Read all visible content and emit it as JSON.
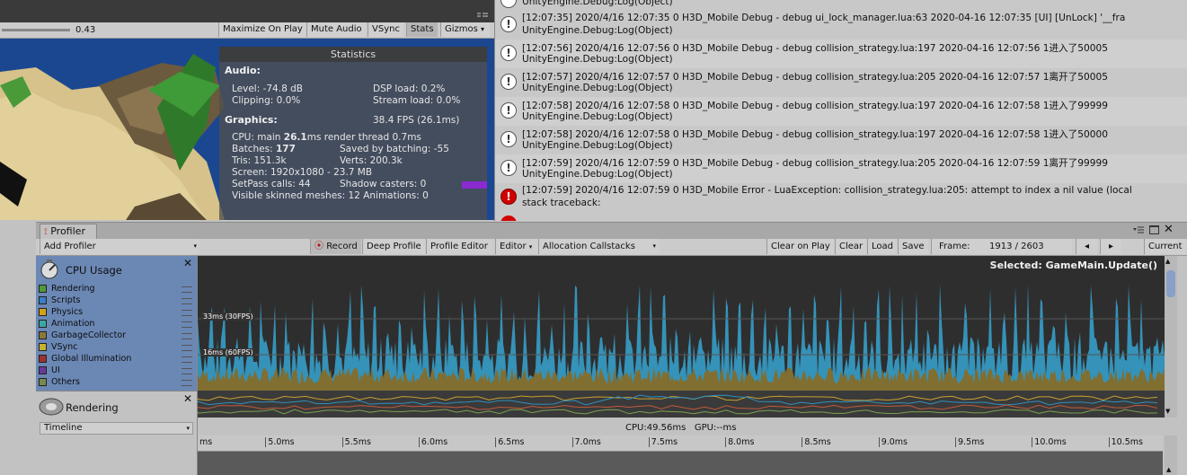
{
  "game_toolbar": {
    "slider_value": "0.43",
    "buttons": [
      "Maximize On Play",
      "Mute Audio",
      "VSync",
      "Stats",
      "Gizmos"
    ],
    "gizmos_arrow": "▾"
  },
  "stats": {
    "title": "Statistics",
    "audio_header": "Audio:",
    "level": "Level: -74.8 dB",
    "clipping": "Clipping: 0.0%",
    "dsp": "DSP load: 0.2%",
    "stream": "Stream load: 0.0%",
    "graphics_header": "Graphics:",
    "fps": "38.4 FPS (26.1ms)",
    "cpu_prefix": "CPU: main ",
    "cpu_main": "26.1",
    "cpu_suffix": "ms  render thread 0.7ms",
    "batches_prefix": "Batches: ",
    "batches": "177",
    "saved": "Saved by batching: -55",
    "tris": "Tris: 151.3k",
    "verts": "Verts: 200.3k",
    "screen": "Screen: 1920x1080 - 23.7 MB",
    "setpass": "SetPass calls: 44",
    "shadow": "Shadow casters: 0",
    "skinned": "Visible skinned meshes: 12  Animations: 0"
  },
  "console": {
    "top_partial": "UnityEngine.Debug:Log(Object)",
    "entries": [
      {
        "type": "log",
        "line1": "[12:07:35] 2020/4/16 12:07:35 0 H3D_Mobile Debug - debug ui_lock_manager.lua:63 2020-04-16 12:07:35  [UI] [UnLock] '__fra",
        "line2": "UnityEngine.Debug:Log(Object)"
      },
      {
        "type": "log",
        "line1": "[12:07:56] 2020/4/16 12:07:56 0 H3D_Mobile Debug - debug collision_strategy.lua:197 2020-04-16 12:07:56  1进入了50005",
        "line2": "UnityEngine.Debug:Log(Object)"
      },
      {
        "type": "log",
        "line1": "[12:07:57] 2020/4/16 12:07:57 0 H3D_Mobile Debug - debug collision_strategy.lua:205 2020-04-16 12:07:57  1离开了50005",
        "line2": "UnityEngine.Debug:Log(Object)"
      },
      {
        "type": "log",
        "line1": "[12:07:58] 2020/4/16 12:07:58 0 H3D_Mobile Debug - debug collision_strategy.lua:197 2020-04-16 12:07:58  1进入了99999",
        "line2": "UnityEngine.Debug:Log(Object)"
      },
      {
        "type": "log",
        "line1": "[12:07:58] 2020/4/16 12:07:58 0 H3D_Mobile Debug - debug collision_strategy.lua:197 2020-04-16 12:07:58  1进入了50000",
        "line2": "UnityEngine.Debug:Log(Object)"
      },
      {
        "type": "log",
        "line1": "[12:07:59] 2020/4/16 12:07:59 0 H3D_Mobile Debug - debug collision_strategy.lua:205 2020-04-16 12:07:59  1离开了99999",
        "line2": "UnityEngine.Debug:Log(Object)"
      },
      {
        "type": "error",
        "line1": "[12:07:59] 2020/4/16 12:07:59 0 H3D_Mobile Error - LuaException: collision_strategy.lua:205: attempt to index a nil value (local",
        "line2": "stack traceback:"
      }
    ]
  },
  "profiler": {
    "tab_label": "Profiler",
    "add_profiler": "Add Profiler",
    "toolbar": {
      "record": "Record",
      "deep_profile": "Deep Profile",
      "profile_editor": "Profile Editor",
      "editor": "Editor",
      "allocation_callstacks": "Allocation Callstacks",
      "clear_on_play": "Clear on Play",
      "clear": "Clear",
      "load": "Load",
      "save": "Save",
      "frame_label": "Frame:",
      "frame_value": "1913 / 2603",
      "current": "Current"
    },
    "cpu_module": {
      "title": "CPU Usage",
      "legend": [
        {
          "name": "Rendering",
          "color": "#4e9a3a"
        },
        {
          "name": "Scripts",
          "color": "#3a7fbf"
        },
        {
          "name": "Physics",
          "color": "#d4a21a"
        },
        {
          "name": "Animation",
          "color": "#3aa7a7"
        },
        {
          "name": "GarbageCollector",
          "color": "#8a7a3a"
        },
        {
          "name": "VSync",
          "color": "#c8b030"
        },
        {
          "name": "Global Illumination",
          "color": "#a03030"
        },
        {
          "name": "UI",
          "color": "#6a3a9a"
        },
        {
          "name": "Others",
          "color": "#7a8a4a"
        }
      ]
    },
    "rendering_module": {
      "title": "Rendering"
    },
    "timeline_select": "Timeline",
    "graph": {
      "selected": "Selected: GameMain.Update()",
      "label_30": "33ms (30FPS)",
      "label_60": "16ms (60FPS)"
    },
    "cpu_gpu": "CPU:49.56ms   GPU:--ms",
    "ruler_ticks": [
      "ms",
      "5.0ms",
      "5.5ms",
      "6.0ms",
      "6.5ms",
      "7.0ms",
      "7.5ms",
      "8.0ms",
      "8.5ms",
      "9.0ms",
      "9.5ms",
      "10.0ms",
      "10.5ms"
    ]
  }
}
